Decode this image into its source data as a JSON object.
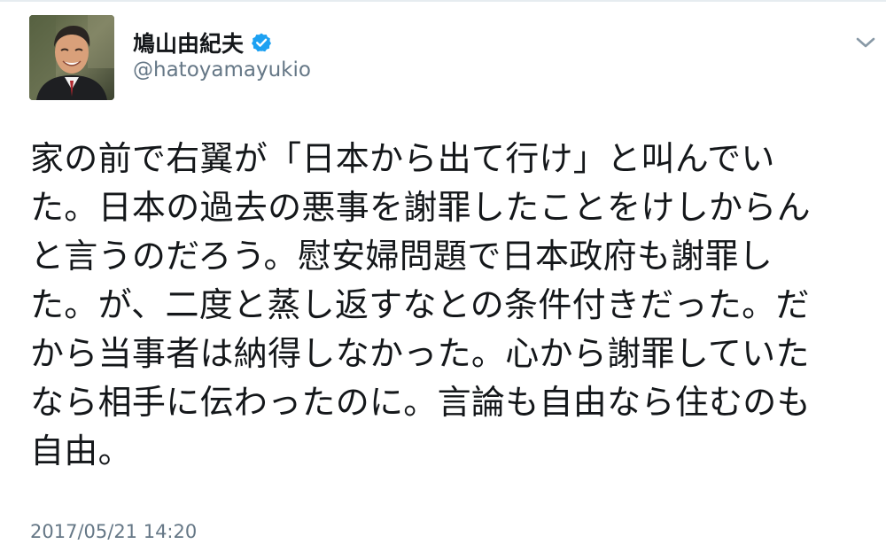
{
  "user": {
    "display_name": "鳩山由紀夫",
    "handle": "@hatoyamayukio",
    "verified": true,
    "avatar_icon": "profile-photo"
  },
  "tweet": {
    "text": "家の前で右翼が「日本から出て行け」と叫んでい\nた。日本の過去の悪事を謝罪したことをけしからん\nと言うのだろう。慰安婦問題で日本政府も謝罪し\nた。が、二度と蒸し返すなとの条件付きだった。だ\nから当事者は納得しなかった。心から謝罪していた\nなら相手に伝わったのに。言論も自由なら住むのも\n自由。",
    "timestamp": "2017/05/21 14:20"
  },
  "menu": {
    "caret_icon": "chevron-down-icon"
  },
  "colors": {
    "text": "#14171a",
    "secondary": "#657786",
    "verified_badge": "#1da1f2",
    "divider": "#e6ecf0"
  }
}
